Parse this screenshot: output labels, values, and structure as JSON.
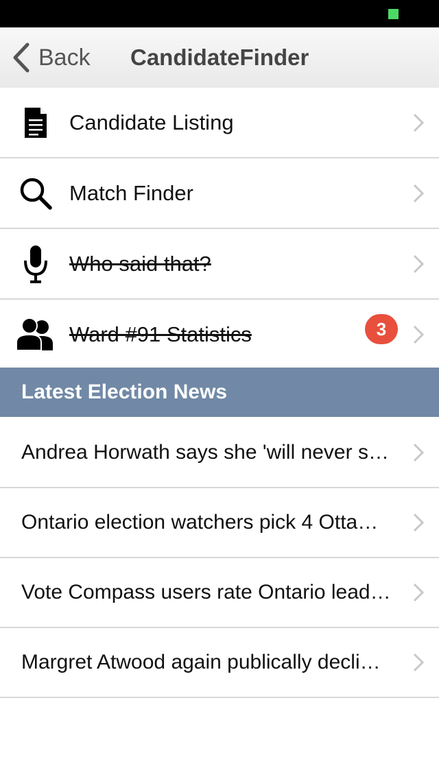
{
  "status_bar": {
    "battery_color": "#4cd964"
  },
  "nav": {
    "back_label": "Back",
    "title": "CandidateFinder"
  },
  "menu": {
    "items": [
      {
        "label": "Candidate Listing",
        "icon": "document-icon",
        "struck": false
      },
      {
        "label": "Match Finder",
        "icon": "search-icon",
        "struck": false
      },
      {
        "label": "Who said that?",
        "icon": "microphone-icon",
        "struck": true
      },
      {
        "label": "Ward #91 Statistics",
        "icon": "people-icon",
        "struck": true,
        "badge": "3"
      }
    ]
  },
  "section": {
    "title": "Latest Election News",
    "color": "#7189a6"
  },
  "news": {
    "items": [
      {
        "headline": "Andrea Horwath says she 'will never s…"
      },
      {
        "headline": "Ontario election watchers pick 4 Otta…"
      },
      {
        "headline": "Vote Compass users rate Ontario lead…"
      },
      {
        "headline": "Margret Atwood again publically decli…"
      }
    ]
  },
  "colors": {
    "badge": "#e8503d",
    "chevron": "#c7c7cc"
  }
}
